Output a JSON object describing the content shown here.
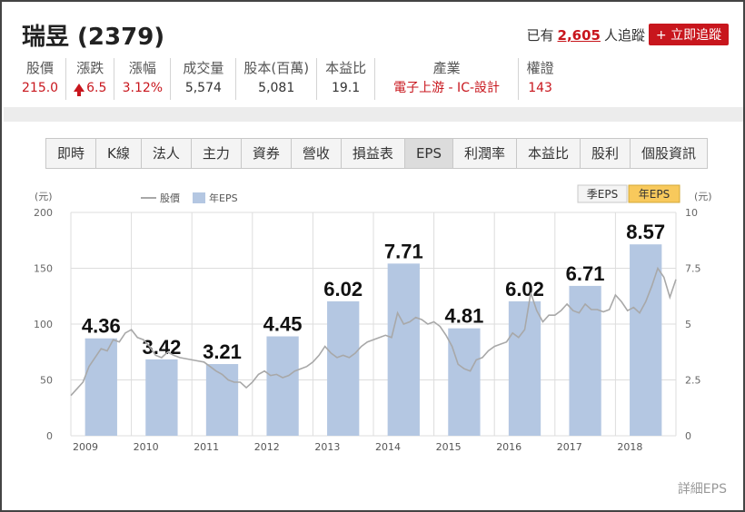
{
  "header": {
    "title": "瑞昱 (2379)",
    "follow_prefix": "已有",
    "follow_count": "2,605",
    "follow_suffix": "人追蹤",
    "follow_button": "+ 立即追蹤"
  },
  "stats": [
    {
      "label": "股價",
      "value": "215.0",
      "color": "red"
    },
    {
      "label": "漲跌",
      "value": "6.5",
      "color": "red",
      "arrow": "up"
    },
    {
      "label": "漲幅",
      "value": "3.12%",
      "color": "red"
    },
    {
      "label": "成交量",
      "value": "5,574",
      "color": "normal"
    },
    {
      "label": "股本(百萬)",
      "value": "5,081",
      "color": "normal"
    },
    {
      "label": "本益比",
      "value": "19.1",
      "color": "normal"
    },
    {
      "label": "產業",
      "value": "電子上游 - IC-設計",
      "color": "red"
    },
    {
      "label": "權證",
      "value": "143",
      "color": "red"
    }
  ],
  "tabs": [
    "即時",
    "K線",
    "法人",
    "主力",
    "資券",
    "營收",
    "損益表",
    "EPS",
    "利潤率",
    "本益比",
    "股利",
    "個股資訊"
  ],
  "active_tab": "EPS",
  "chart_toggle": {
    "quarter": "季EPS",
    "year": "年EPS",
    "active": "year"
  },
  "detail_link": "詳細EPS",
  "colors": {
    "accent": "#c8161d",
    "bar": "#b4c7e2",
    "line": "#a8a8a8",
    "toggle_active": "#f8c95c"
  },
  "chart_data": {
    "type": "bar",
    "left_axis_unit": "(元)",
    "right_axis_unit": "(元)",
    "legend": [
      {
        "name": "股價",
        "kind": "line"
      },
      {
        "name": "年EPS",
        "kind": "bar"
      }
    ],
    "legend_placement": "top-left",
    "categories": [
      "2009",
      "2010",
      "2011",
      "2012",
      "2013",
      "2014",
      "2015",
      "2016",
      "2017",
      "2018"
    ],
    "eps_values": [
      4.36,
      3.42,
      3.21,
      4.45,
      6.02,
      7.71,
      4.81,
      6.02,
      6.71,
      8.57
    ],
    "eps_labels": [
      "4.36",
      "3.42",
      "3.21",
      "4.45",
      "6.02",
      "7.71",
      "4.81",
      "6.02",
      "6.71",
      "8.57"
    ],
    "left_ylim": [
      0,
      200
    ],
    "left_ticks": [
      "0",
      "50",
      "100",
      "150",
      "200"
    ],
    "right_ylim": [
      0,
      10
    ],
    "right_ticks": [
      "0",
      "2.5",
      "5",
      "7.5",
      "10"
    ],
    "x_range": [
      2009,
      2019
    ],
    "price_series": {
      "name": "股價",
      "x": [
        2009.0,
        2009.1,
        2009.2,
        2009.3,
        2009.4,
        2009.5,
        2009.6,
        2009.7,
        2009.8,
        2009.9,
        2010.0,
        2010.1,
        2010.2,
        2010.3,
        2010.4,
        2010.5,
        2010.6,
        2010.7,
        2010.8,
        2010.9,
        2011.0,
        2011.1,
        2011.2,
        2011.3,
        2011.4,
        2011.5,
        2011.6,
        2011.7,
        2011.8,
        2011.9,
        2012.0,
        2012.1,
        2012.2,
        2012.3,
        2012.4,
        2012.5,
        2012.6,
        2012.7,
        2012.8,
        2012.9,
        2013.0,
        2013.1,
        2013.2,
        2013.3,
        2013.4,
        2013.5,
        2013.6,
        2013.7,
        2013.8,
        2013.9,
        2014.0,
        2014.1,
        2014.2,
        2014.3,
        2014.4,
        2014.5,
        2014.6,
        2014.7,
        2014.8,
        2014.9,
        2015.0,
        2015.1,
        2015.2,
        2015.3,
        2015.4,
        2015.5,
        2015.6,
        2015.7,
        2015.8,
        2015.9,
        2016.0,
        2016.1,
        2016.2,
        2016.3,
        2016.4,
        2016.5,
        2016.6,
        2016.7,
        2016.8,
        2016.9,
        2017.0,
        2017.1,
        2017.2,
        2017.3,
        2017.4,
        2017.5,
        2017.6,
        2017.7,
        2017.8,
        2017.9,
        2018.0,
        2018.1,
        2018.2,
        2018.3,
        2018.4,
        2018.5,
        2018.6,
        2018.7,
        2018.8,
        2018.9,
        2019.0
      ],
      "values": [
        36,
        42,
        48,
        62,
        70,
        78,
        76,
        86,
        84,
        92,
        95,
        88,
        86,
        80,
        72,
        70,
        75,
        72,
        70,
        69,
        68,
        67,
        66,
        62,
        58,
        55,
        50,
        48,
        48,
        43,
        48,
        55,
        58,
        54,
        55,
        52,
        54,
        58,
        60,
        62,
        66,
        72,
        80,
        74,
        70,
        72,
        70,
        74,
        80,
        84,
        86,
        88,
        90,
        88,
        110,
        100,
        102,
        106,
        104,
        100,
        102,
        98,
        90,
        80,
        64,
        60,
        58,
        68,
        70,
        76,
        80,
        82,
        84,
        92,
        88,
        95,
        128,
        112,
        102,
        108,
        108,
        112,
        118,
        112,
        110,
        118,
        113,
        113,
        111,
        113,
        126,
        120,
        112,
        115,
        110,
        120,
        134,
        150,
        142,
        124,
        140
      ]
    }
  }
}
